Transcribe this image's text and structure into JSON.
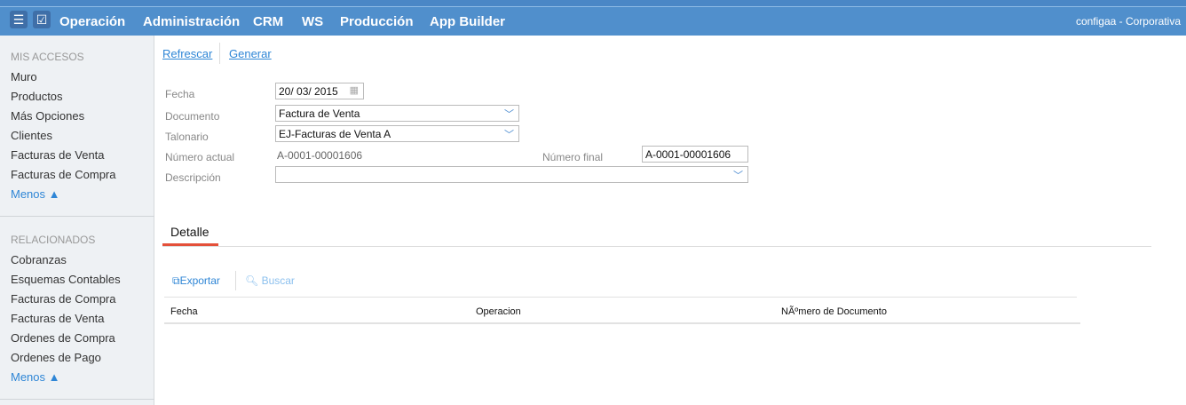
{
  "header": {
    "menu": [
      "Operación",
      "Administración",
      "CRM",
      "WS",
      "Producción",
      "App Builder"
    ],
    "user": "configaa - Corporativa"
  },
  "sidebar": {
    "mis_accesos": "MIS ACCESOS",
    "items1": [
      "Muro",
      "Productos",
      "Más Opciones",
      "Clientes",
      "Facturas de Venta",
      "Facturas de Compra"
    ],
    "menos": "Menos ▲",
    "relacionados": "RELACIONADOS",
    "items2": [
      "Cobranzas",
      "Esquemas Contables",
      "Facturas de Compra",
      "Facturas de Venta",
      "Ordenes de Compra",
      "Ordenes de Pago"
    ]
  },
  "toolbar": {
    "refrescar": "Refrescar",
    "generar": "Generar"
  },
  "form": {
    "fecha_label": "Fecha",
    "fecha": "20/ 03/ 2015",
    "documento_label": "Documento",
    "documento": "Factura de Venta",
    "talonario_label": "Talonario",
    "talonario": "EJ-Facturas de Venta A",
    "numero_actual_label": "Número actual",
    "numero_actual": "A-0001-00001606",
    "numero_final_label": "Número final",
    "numero_final": "A-0001-00001606",
    "descripcion_label": "Descripción",
    "descripcion": ""
  },
  "detail": {
    "tab": "Detalle",
    "exportar": "Exportar",
    "buscar": "Buscar",
    "columns": [
      "Fecha",
      "Operacion",
      "NÃºmero de Documento"
    ]
  }
}
